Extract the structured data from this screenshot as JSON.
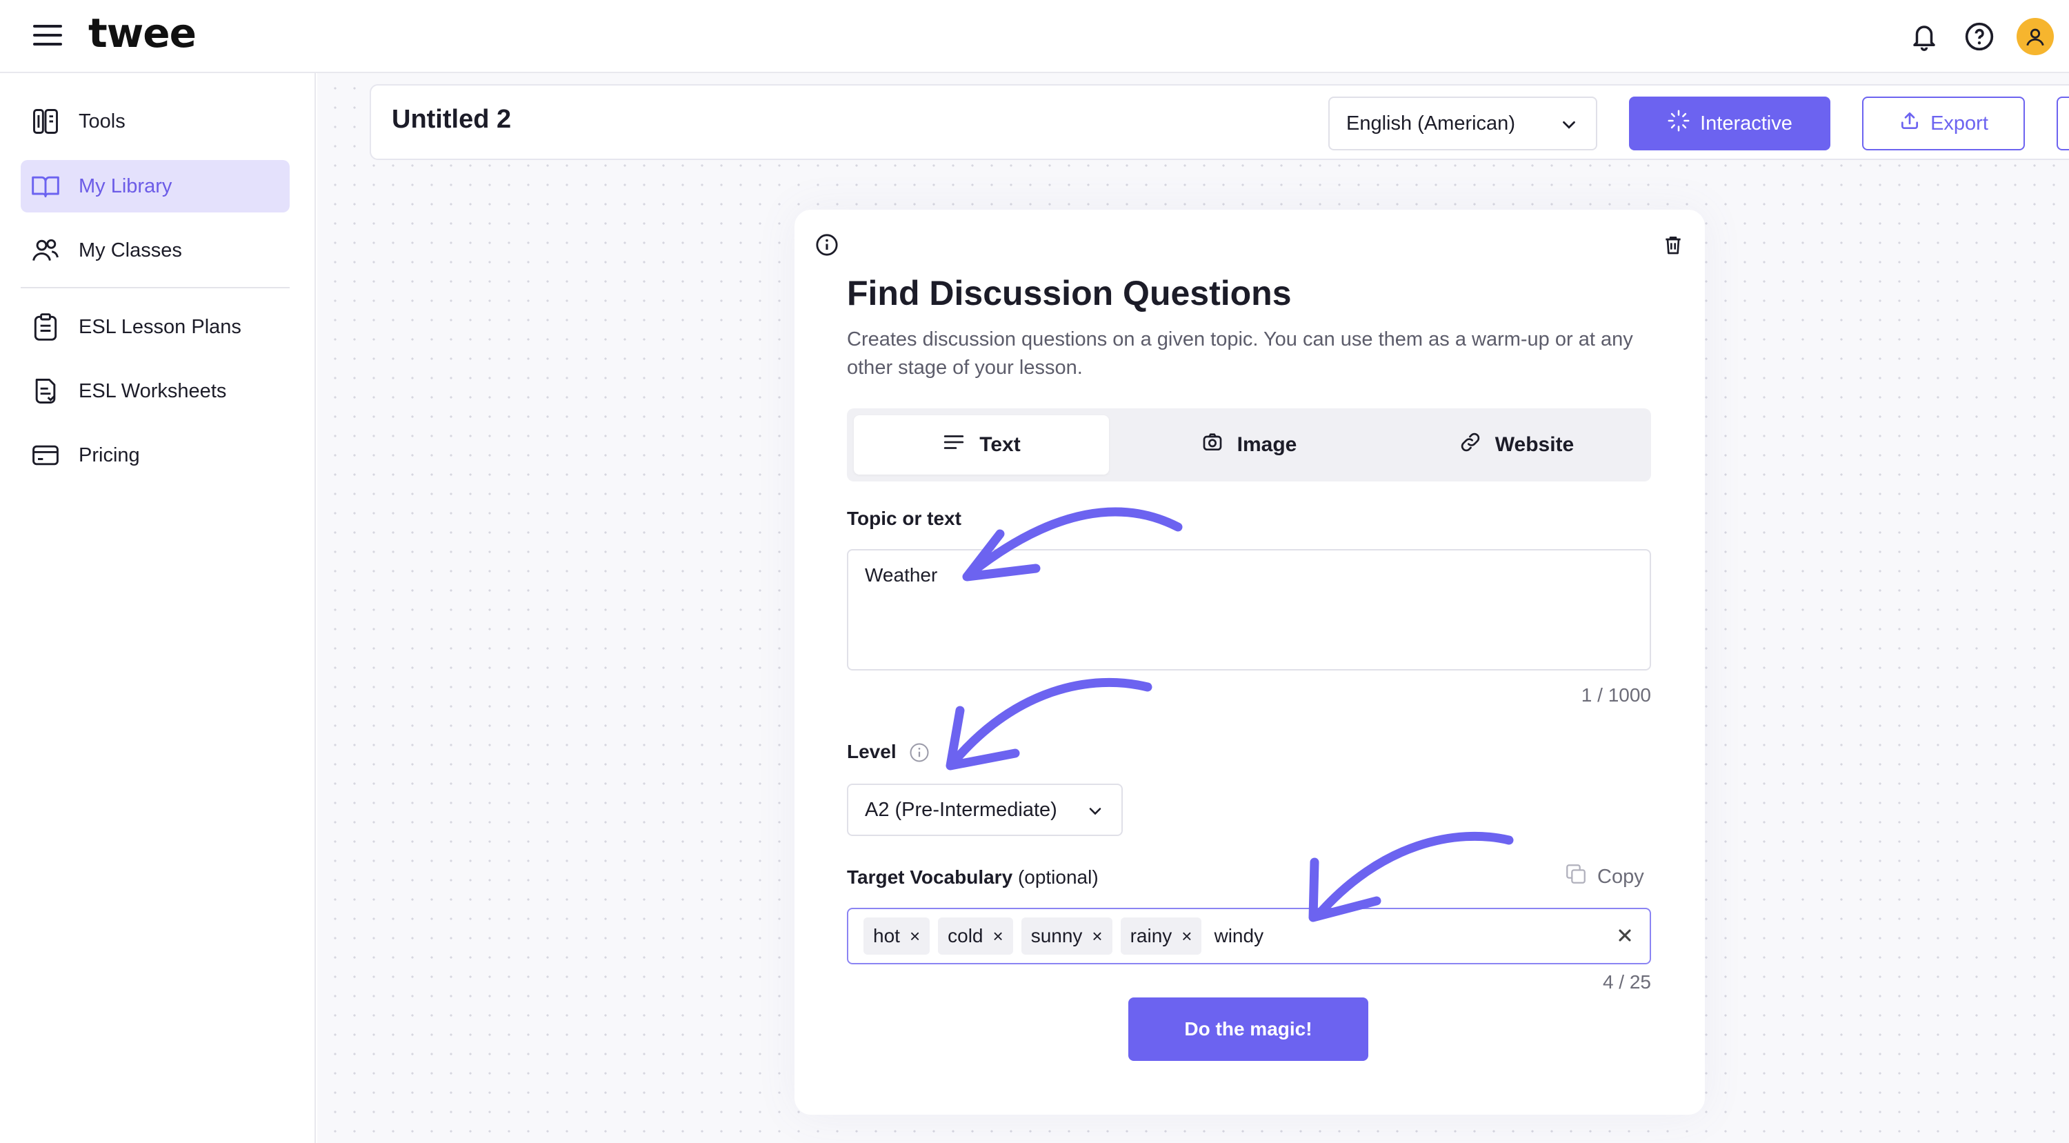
{
  "app": {
    "logo": "twee"
  },
  "topbar": {
    "icons": [
      "menu-icon",
      "bell-icon",
      "help-icon",
      "user-avatar-icon"
    ]
  },
  "sidebar": {
    "items": [
      {
        "label": "Tools",
        "icon": "tools-icon"
      },
      {
        "label": "My Library",
        "icon": "book-icon",
        "active": true
      },
      {
        "label": "My Classes",
        "icon": "users-icon"
      },
      {
        "label": "ESL Lesson Plans",
        "icon": "clipboard-icon"
      },
      {
        "label": "ESL Worksheets",
        "icon": "worksheet-icon"
      },
      {
        "label": "Pricing",
        "icon": "card-icon"
      }
    ]
  },
  "header": {
    "title": "Untitled 2",
    "language": "English (American)",
    "interactive_label": "Interactive",
    "export_label": "Export"
  },
  "card": {
    "title": "Find Discussion Questions",
    "description": "Creates discussion questions on a given topic. You can use them as a warm-up or at any other stage of your lesson.",
    "tabs": [
      {
        "label": "Text",
        "icon": "lines-icon",
        "active": true
      },
      {
        "label": "Image",
        "icon": "camera-icon"
      },
      {
        "label": "Website",
        "icon": "link-icon"
      }
    ],
    "topic_label": "Topic or text",
    "topic_value": "Weather",
    "topic_counter": "1 / 1000",
    "level_label": "Level",
    "level_value": "A2 (Pre-Intermediate)",
    "vocab_label": "Target Vocabulary",
    "vocab_optional": "(optional)",
    "copy_label": "Copy",
    "vocab_chips": [
      "hot",
      "cold",
      "sunny",
      "rainy"
    ],
    "vocab_input": "windy",
    "vocab_counter": "4 / 25",
    "submit_label": "Do the magic!"
  },
  "colors": {
    "accent": "#6c63f0",
    "active_nav_bg": "#e4e1fc",
    "arrow": "#6c63f0",
    "avatar": "#f6b52e"
  }
}
